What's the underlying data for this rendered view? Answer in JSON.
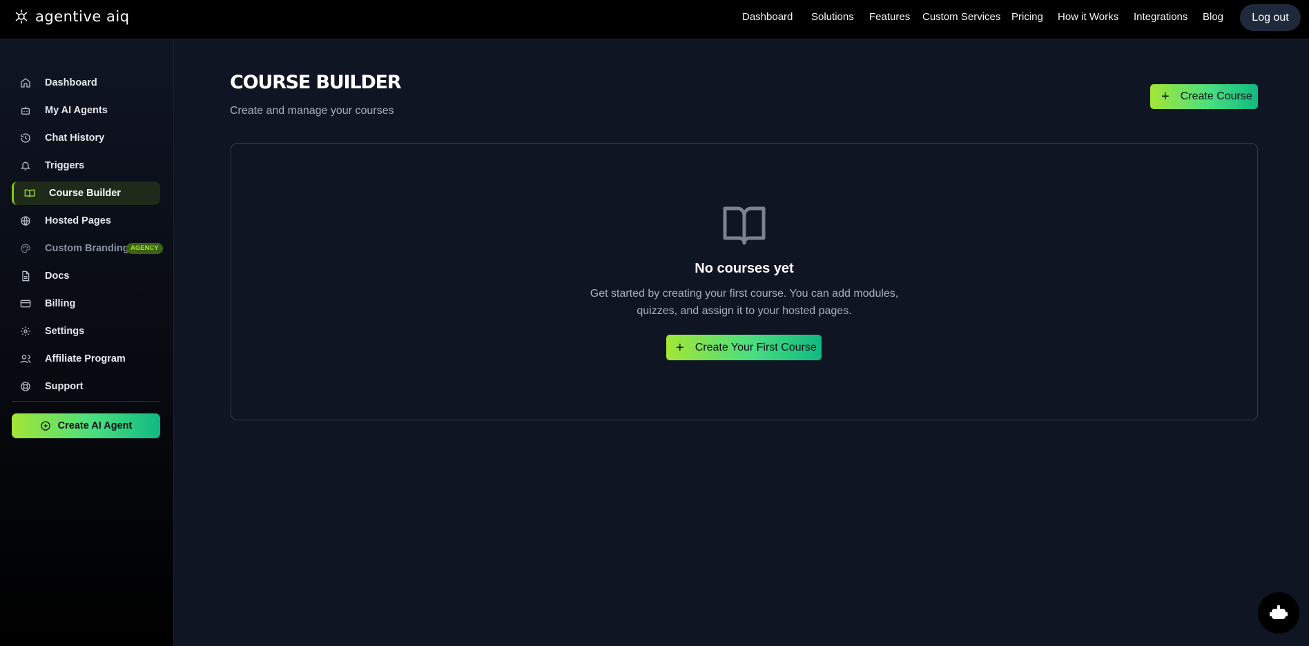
{
  "header": {
    "logo_text": "agentive aiq",
    "nav": [
      {
        "label": "Dashboard"
      },
      {
        "label": "Solutions"
      },
      {
        "label": "Features"
      },
      {
        "label": "Custom Services"
      },
      {
        "label": "Pricing"
      },
      {
        "label": "How it Works"
      },
      {
        "label": "Integrations"
      },
      {
        "label": "Blog"
      }
    ],
    "logout_label": "Log out"
  },
  "sidebar": {
    "items": [
      {
        "label": "Dashboard",
        "icon": "home-icon"
      },
      {
        "label": "My AI Agents",
        "icon": "bot-icon"
      },
      {
        "label": "Chat History",
        "icon": "history-icon"
      },
      {
        "label": "Triggers",
        "icon": "bell-icon"
      },
      {
        "label": "Course Builder",
        "icon": "book-open-icon",
        "active": true
      },
      {
        "label": "Hosted Pages",
        "icon": "globe-icon"
      },
      {
        "label": "Custom Branding",
        "icon": "palette-icon",
        "badge": "AGENCY"
      },
      {
        "label": "Docs",
        "icon": "file-text-icon"
      },
      {
        "label": "Billing",
        "icon": "credit-card-icon"
      },
      {
        "label": "Settings",
        "icon": "gear-icon"
      },
      {
        "label": "Affiliate Program",
        "icon": "users-icon"
      },
      {
        "label": "Support",
        "icon": "lifebuoy-icon"
      }
    ],
    "create_agent_label": "Create AI Agent"
  },
  "main": {
    "title": "COURSE BUILDER",
    "subtitle": "Create and manage your courses",
    "create_course_label": "Create Course",
    "empty_state": {
      "title": "No courses yet",
      "description": "Get started by creating your first course. You can add modules, quizzes, and assign it to your hosted pages.",
      "button_label": "Create Your First Course"
    }
  },
  "colors": {
    "accent_start": "#a3e635",
    "accent_end": "#10b981",
    "background": "#0f1523"
  }
}
